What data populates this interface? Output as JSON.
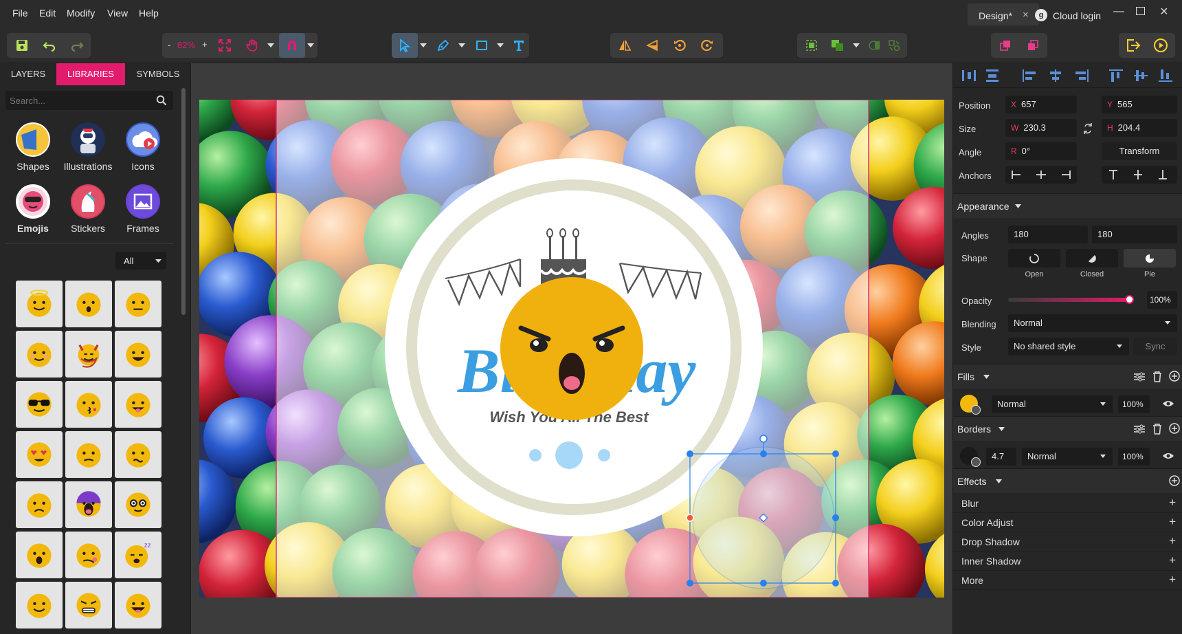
{
  "menu": [
    "File",
    "Edit",
    "Modify",
    "View",
    "Help"
  ],
  "window": {
    "doc_tab": "Design*",
    "cloud": "Cloud login"
  },
  "toolbar": {
    "zoom_minus": "-",
    "zoom": "82%",
    "zoom_plus": "+"
  },
  "left_panel": {
    "tabs": [
      "LAYERS",
      "LIBRARIES",
      "SYMBOLS"
    ],
    "active_tab": "LIBRARIES",
    "search_placeholder": "Search...",
    "libraries": [
      "Shapes",
      "Illustrations",
      "Icons",
      "Emojis",
      "Stickers",
      "Frames"
    ],
    "active_library": "Emojis",
    "filter": "All"
  },
  "canvas": {
    "title_part1": "Bi",
    "title_part2": "lay",
    "subtitle": "Wish You All The Best"
  },
  "right_panel": {
    "position": {
      "label": "Position",
      "x_prefix": "X",
      "x": "657",
      "y_prefix": "Y",
      "y": "565"
    },
    "size": {
      "label": "Size",
      "w_prefix": "W",
      "w": "230.3",
      "h_prefix": "H",
      "h": "204.4"
    },
    "angle": {
      "label": "Angle",
      "r_prefix": "R",
      "r": "0°",
      "transform": "Transform"
    },
    "anchors": {
      "label": "Anchors"
    },
    "appearance": {
      "title": "Appearance",
      "angles_label": "Angles",
      "angle1": "180",
      "angle2": "180",
      "shape_label": "Shape",
      "shapes": [
        "Open",
        "Closed",
        "Pie"
      ],
      "active_shape": "Pie",
      "opacity_label": "Opacity",
      "opacity": "100%",
      "opacity_value": 1.0,
      "blending_label": "Blending",
      "blending": "Normal",
      "style_label": "Style",
      "style": "No shared style",
      "sync": "Sync"
    },
    "fills": {
      "title": "Fills",
      "blend": "Normal",
      "opacity": "100%",
      "color": "#f2b90c"
    },
    "borders": {
      "title": "Borders",
      "width": "4.7",
      "blend": "Normal",
      "opacity": "100%",
      "color": "#1a1a1a"
    },
    "effects": {
      "title": "Effects",
      "items": [
        "Blur",
        "Color Adjust",
        "Drop Shadow",
        "Inner Shadow",
        "More"
      ]
    }
  },
  "colors": {
    "accent": "#e31b6d",
    "selection": "#2a7ff0",
    "title_blue": "#3a9ee0",
    "emoji_orange": "#f0b00e"
  }
}
